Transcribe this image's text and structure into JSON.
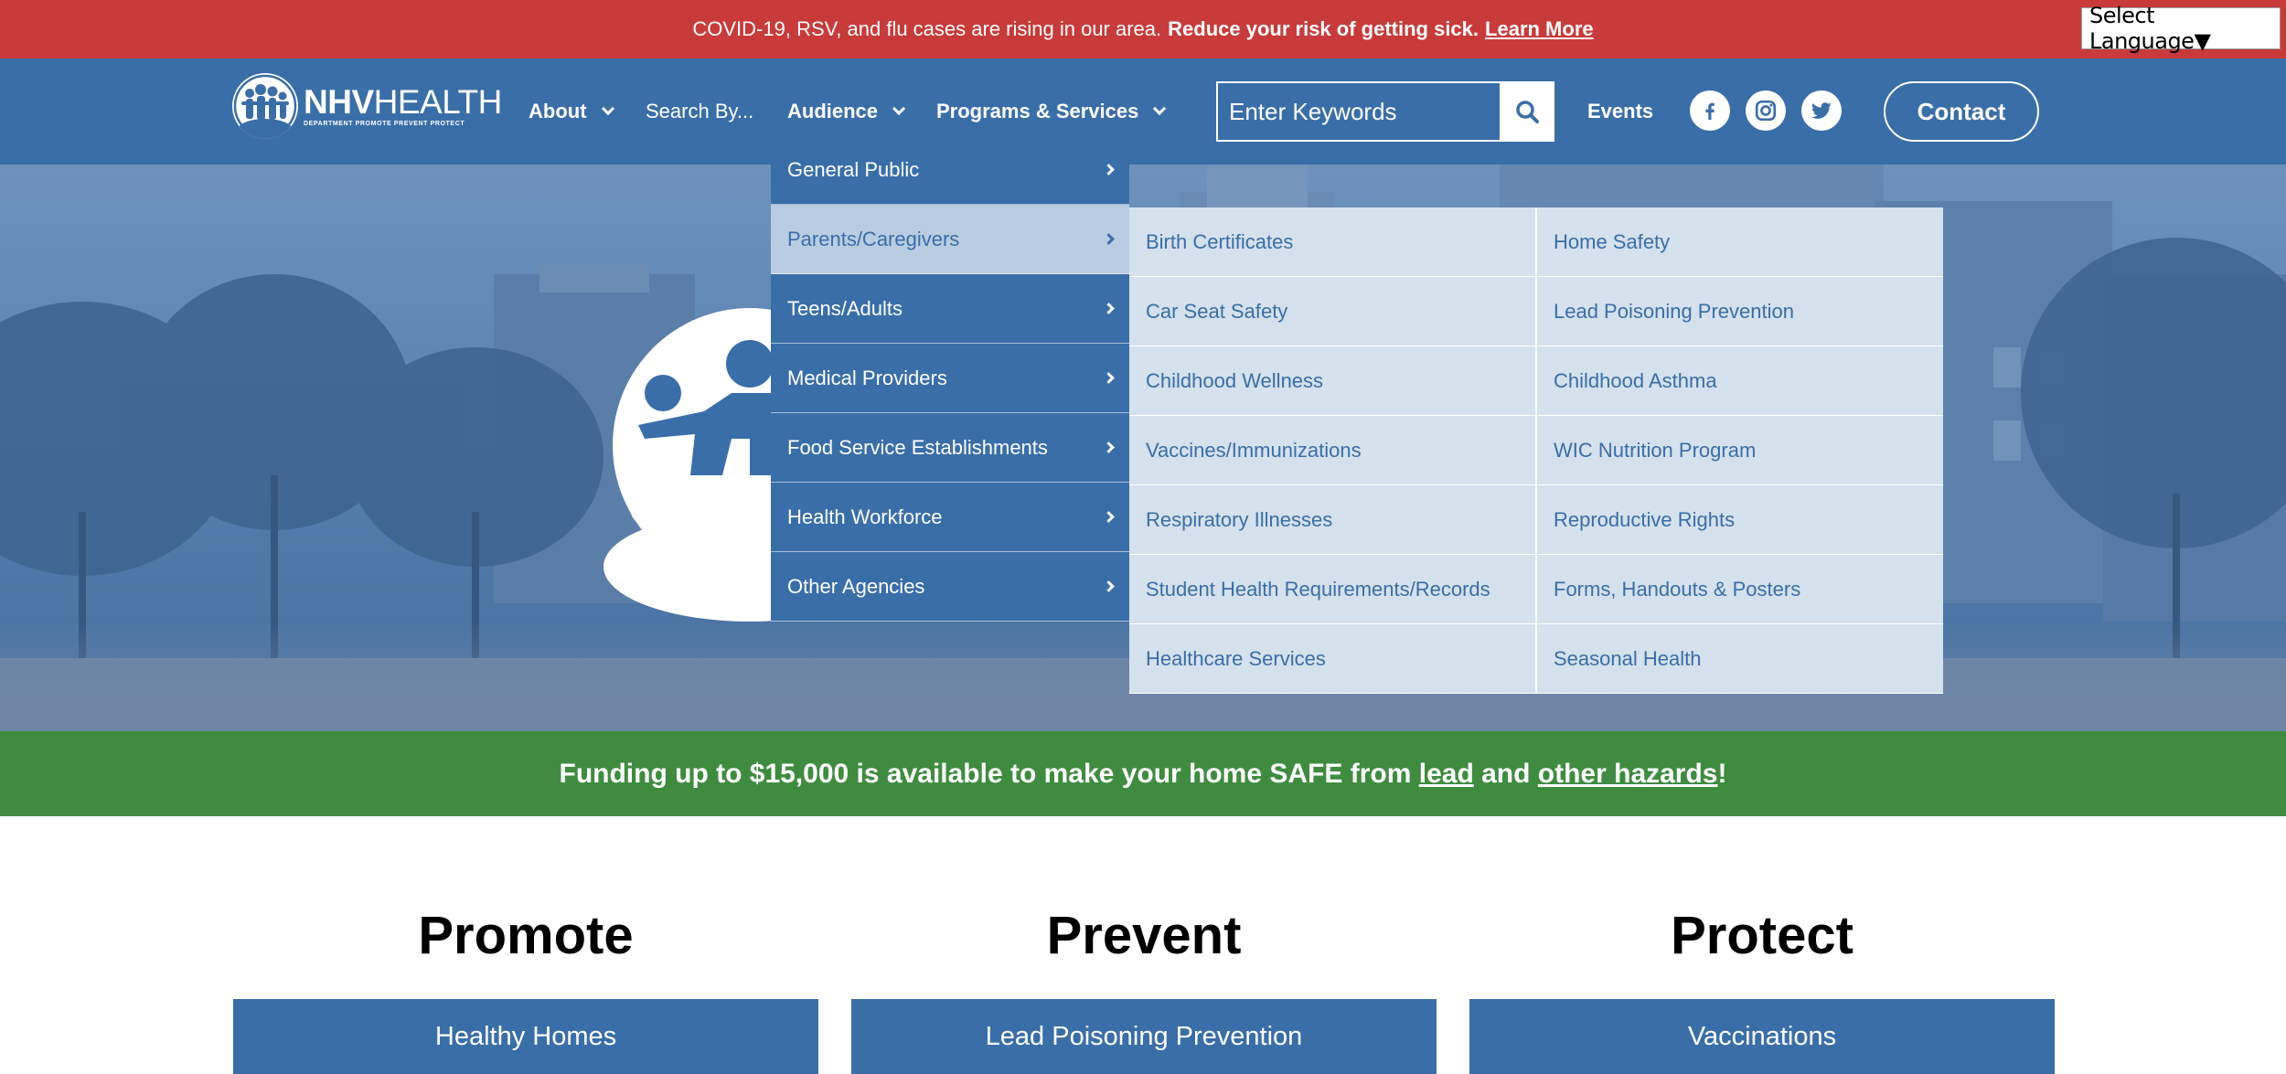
{
  "alert": {
    "text": "COVID-19, RSV, and flu cases are rising in our area.",
    "strong": "Reduce your risk of getting sick.",
    "link": "Learn More"
  },
  "language": {
    "label": "Select Language▼"
  },
  "logo": {
    "word_bold": "NHV",
    "word_rest": "HEALTH",
    "tagline": "DEPARTMENT PROMOTE PREVENT PROTECT"
  },
  "nav": {
    "about": "About",
    "search_by": "Search By...",
    "audience": "Audience",
    "programs": "Programs & Services",
    "events": "Events",
    "contact": "Contact"
  },
  "search": {
    "placeholder": "Enter Keywords"
  },
  "audience_menu": [
    {
      "label": "General Public"
    },
    {
      "label": "Parents/Caregivers",
      "active": true
    },
    {
      "label": "Teens/Adults"
    },
    {
      "label": "Medical Providers"
    },
    {
      "label": "Food Service Establishments"
    },
    {
      "label": "Health Workforce"
    },
    {
      "label": "Other Agencies"
    }
  ],
  "submenu": {
    "left": [
      "Birth Certificates",
      "Car Seat Safety",
      "Childhood Wellness",
      "Vaccines/Immunizations",
      "Respiratory Illnesses",
      "Student Health Requirements/Records",
      "Healthcare Services"
    ],
    "right": [
      "Home Safety",
      "Lead Poisoning Prevention",
      "Childhood Asthma",
      "WIC Nutrition Program",
      "Reproductive Rights",
      "Forms, Handouts & Posters",
      "Seasonal Health"
    ]
  },
  "funding": {
    "pre": "Funding up to $15,000 is available to make your home SAFE from ",
    "link1": "lead",
    "mid": " and ",
    "link2": "other hazards",
    "post": "!"
  },
  "columns": [
    {
      "heading": "Promote",
      "button": "Healthy Homes"
    },
    {
      "heading": "Prevent",
      "button": "Lead Poisoning Prevention"
    },
    {
      "heading": "Protect",
      "button": "Vaccinations"
    }
  ],
  "colors": {
    "alert_red": "#c93a3a",
    "brand_blue": "#3a6ea8",
    "submenu_bg": "#d5e1ec",
    "active_item": "#b9cde2",
    "funding_green": "#3f8c40"
  },
  "icons": [
    "search-icon",
    "facebook-icon",
    "instagram-icon",
    "twitter-icon",
    "chevron-down-icon",
    "chevron-right-icon"
  ]
}
